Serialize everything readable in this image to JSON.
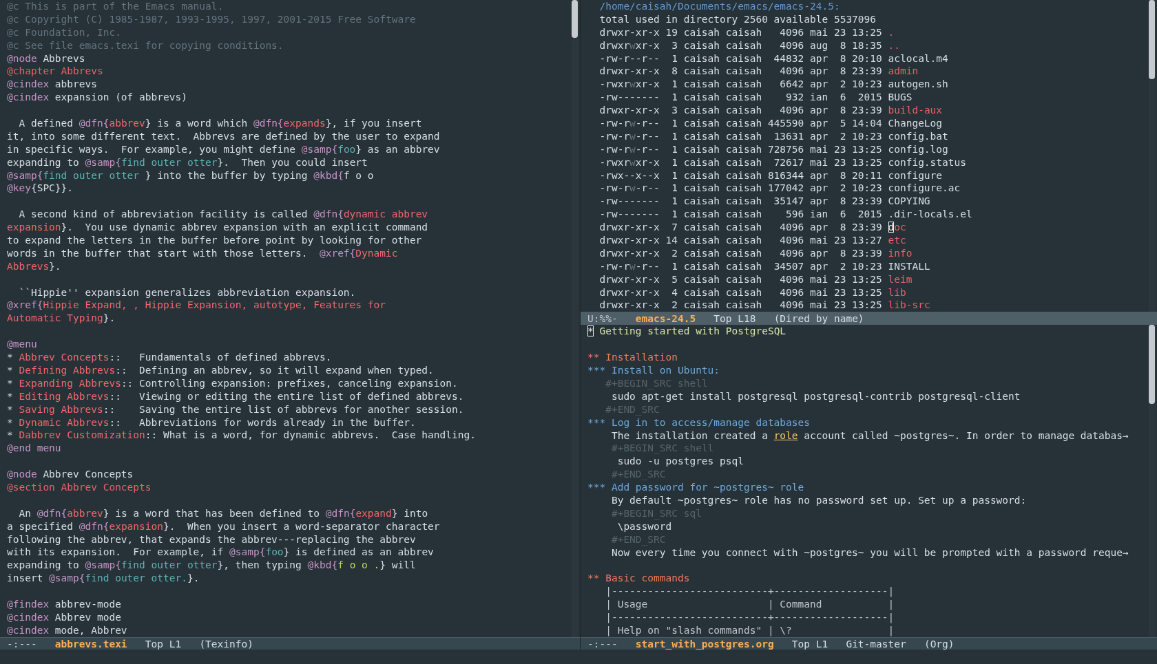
{
  "left_window": {
    "active": false,
    "lines": [
      {
        "kind": "text",
        "spans": [
          {
            "kind": "comment",
            "text": "@c This is part of the Emacs manual."
          }
        ]
      },
      {
        "kind": "text",
        "spans": [
          {
            "kind": "comment",
            "text": "@c Copyright (C) 1985-1987, 1993-1995, 1997, 2001-2015 Free Software"
          }
        ]
      },
      {
        "kind": "text",
        "spans": [
          {
            "kind": "comment",
            "text": "@c Foundation, Inc."
          }
        ]
      },
      {
        "kind": "text",
        "spans": [
          {
            "kind": "comment",
            "text": "@c See file emacs.texi for copying conditions."
          }
        ]
      },
      {
        "kind": "text",
        "spans": [
          {
            "kind": "kw",
            "text": "@node"
          },
          {
            "kind": "plain",
            "text": " Abbrevs"
          }
        ]
      },
      {
        "kind": "text",
        "spans": [
          {
            "kind": "chapter",
            "text": "@chapter Abbrevs"
          }
        ]
      },
      {
        "kind": "text",
        "spans": [
          {
            "kind": "kw",
            "text": "@cindex"
          },
          {
            "kind": "plain",
            "text": " abbrevs"
          }
        ]
      },
      {
        "kind": "text",
        "spans": [
          {
            "kind": "kw",
            "text": "@cindex"
          },
          {
            "kind": "plain",
            "text": " expansion (of abbrevs)"
          }
        ]
      },
      {
        "kind": "blank"
      },
      {
        "kind": "text",
        "spans": [
          {
            "kind": "plain",
            "text": "  A defined "
          },
          {
            "kind": "kw",
            "text": "@dfn{"
          },
          {
            "kind": "str",
            "text": "abbrev"
          },
          {
            "kind": "plain",
            "text": "} is a word which "
          },
          {
            "kind": "kw",
            "text": "@dfn{"
          },
          {
            "kind": "str",
            "text": "expands"
          },
          {
            "kind": "plain",
            "text": "}, if you insert"
          }
        ]
      },
      {
        "kind": "text",
        "spans": [
          {
            "kind": "plain",
            "text": "it, into some different text.  Abbrevs are defined by the user to expand"
          }
        ]
      },
      {
        "kind": "text",
        "spans": [
          {
            "kind": "plain",
            "text": "in specific ways.  For example, you might define "
          },
          {
            "kind": "kw",
            "text": "@samp{"
          },
          {
            "kind": "samp",
            "text": "foo"
          },
          {
            "kind": "plain",
            "text": "} as an abbrev"
          }
        ]
      },
      {
        "kind": "text",
        "spans": [
          {
            "kind": "plain",
            "text": "expanding to "
          },
          {
            "kind": "kw",
            "text": "@samp{"
          },
          {
            "kind": "samp",
            "text": "find outer otter"
          },
          {
            "kind": "plain",
            "text": "}.  Then you could insert"
          }
        ]
      },
      {
        "kind": "text",
        "spans": [
          {
            "kind": "kw",
            "text": "@samp{"
          },
          {
            "kind": "samp",
            "text": "find outer otter "
          },
          {
            "kind": "plain",
            "text": "} into the buffer by typing "
          },
          {
            "kind": "kw",
            "text": "@kbd{"
          },
          {
            "kind": "plain",
            "text": "f o o"
          }
        ]
      },
      {
        "kind": "text",
        "spans": [
          {
            "kind": "kw",
            "text": "@key"
          },
          {
            "kind": "plain",
            "text": "{SPC}}."
          }
        ]
      },
      {
        "kind": "blank"
      },
      {
        "kind": "text",
        "spans": [
          {
            "kind": "plain",
            "text": "  A second kind of abbreviation facility is called "
          },
          {
            "kind": "kw",
            "text": "@dfn{"
          },
          {
            "kind": "str",
            "text": "dynamic abbrev"
          }
        ]
      },
      {
        "kind": "text",
        "spans": [
          {
            "kind": "str",
            "text": "expansion"
          },
          {
            "kind": "plain",
            "text": "}.  You use dynamic abbrev expansion with an explicit command"
          }
        ]
      },
      {
        "kind": "text",
        "spans": [
          {
            "kind": "plain",
            "text": "to expand the letters in the buffer before point by looking for other"
          }
        ]
      },
      {
        "kind": "text",
        "spans": [
          {
            "kind": "plain",
            "text": "words in the buffer that start with those letters.  "
          },
          {
            "kind": "kw",
            "text": "@xref{"
          },
          {
            "kind": "str",
            "text": "Dynamic"
          }
        ]
      },
      {
        "kind": "text",
        "spans": [
          {
            "kind": "str",
            "text": "Abbrevs"
          },
          {
            "kind": "plain",
            "text": "}."
          }
        ]
      },
      {
        "kind": "blank"
      },
      {
        "kind": "text",
        "spans": [
          {
            "kind": "plain",
            "text": "  ``Hippie'' expansion generalizes abbreviation expansion."
          }
        ]
      },
      {
        "kind": "text",
        "spans": [
          {
            "kind": "kw",
            "text": "@xref{"
          },
          {
            "kind": "str",
            "text": "Hippie Expand, , Hippie Expansion, autotype, Features for"
          }
        ]
      },
      {
        "kind": "text",
        "spans": [
          {
            "kind": "str",
            "text": "Automatic Typing"
          },
          {
            "kind": "plain",
            "text": "}."
          }
        ]
      },
      {
        "kind": "blank"
      },
      {
        "kind": "text",
        "spans": [
          {
            "kind": "kw",
            "text": "@menu"
          }
        ]
      },
      {
        "kind": "text",
        "spans": [
          {
            "kind": "plain",
            "text": "* "
          },
          {
            "kind": "str",
            "text": "Abbrev Concepts"
          },
          {
            "kind": "plain",
            "text": "::   Fundamentals of defined abbrevs."
          }
        ]
      },
      {
        "kind": "text",
        "spans": [
          {
            "kind": "plain",
            "text": "* "
          },
          {
            "kind": "str",
            "text": "Defining Abbrevs"
          },
          {
            "kind": "plain",
            "text": "::  Defining an abbrev, so it will expand when typed."
          }
        ]
      },
      {
        "kind": "text",
        "spans": [
          {
            "kind": "plain",
            "text": "* "
          },
          {
            "kind": "str",
            "text": "Expanding Abbrevs"
          },
          {
            "kind": "plain",
            "text": ":: Controlling expansion: prefixes, canceling expansion."
          }
        ]
      },
      {
        "kind": "text",
        "spans": [
          {
            "kind": "plain",
            "text": "* "
          },
          {
            "kind": "str",
            "text": "Editing Abbrevs"
          },
          {
            "kind": "plain",
            "text": "::   Viewing or editing the entire list of defined abbrevs."
          }
        ]
      },
      {
        "kind": "text",
        "spans": [
          {
            "kind": "plain",
            "text": "* "
          },
          {
            "kind": "str",
            "text": "Saving Abbrevs"
          },
          {
            "kind": "plain",
            "text": "::    Saving the entire list of abbrevs for another session."
          }
        ]
      },
      {
        "kind": "text",
        "spans": [
          {
            "kind": "plain",
            "text": "* "
          },
          {
            "kind": "str",
            "text": "Dynamic Abbrevs"
          },
          {
            "kind": "plain",
            "text": "::   Abbreviations for words already in the buffer."
          }
        ]
      },
      {
        "kind": "text",
        "spans": [
          {
            "kind": "plain",
            "text": "* "
          },
          {
            "kind": "str",
            "text": "Dabbrev Customization"
          },
          {
            "kind": "plain",
            "text": ":: What is a word, for dynamic abbrevs.  Case handling."
          }
        ]
      },
      {
        "kind": "text",
        "spans": [
          {
            "kind": "kw",
            "text": "@end menu"
          }
        ]
      },
      {
        "kind": "blank"
      },
      {
        "kind": "text",
        "spans": [
          {
            "kind": "kw",
            "text": "@node"
          },
          {
            "kind": "plain",
            "text": " Abbrev Concepts"
          }
        ]
      },
      {
        "kind": "text",
        "spans": [
          {
            "kind": "chapter",
            "text": "@section Abbrev Concepts"
          }
        ]
      },
      {
        "kind": "blank"
      },
      {
        "kind": "text",
        "spans": [
          {
            "kind": "plain",
            "text": "  An "
          },
          {
            "kind": "kw",
            "text": "@dfn{"
          },
          {
            "kind": "str",
            "text": "abbrev"
          },
          {
            "kind": "plain",
            "text": "} is a word that has been defined to "
          },
          {
            "kind": "kw",
            "text": "@dfn{"
          },
          {
            "kind": "str",
            "text": "expand"
          },
          {
            "kind": "plain",
            "text": "} into"
          }
        ]
      },
      {
        "kind": "text",
        "spans": [
          {
            "kind": "plain",
            "text": "a specified "
          },
          {
            "kind": "kw",
            "text": "@dfn{"
          },
          {
            "kind": "str",
            "text": "expansion"
          },
          {
            "kind": "plain",
            "text": "}.  When you insert a word-separator character"
          }
        ]
      },
      {
        "kind": "text",
        "spans": [
          {
            "kind": "plain",
            "text": "following the abbrev, that expands the abbrev---replacing the abbrev"
          }
        ]
      },
      {
        "kind": "text",
        "spans": [
          {
            "kind": "plain",
            "text": "with its expansion.  For example, if "
          },
          {
            "kind": "kw",
            "text": "@samp{"
          },
          {
            "kind": "samp",
            "text": "foo"
          },
          {
            "kind": "plain",
            "text": "} is defined as an abbrev"
          }
        ]
      },
      {
        "kind": "text",
        "spans": [
          {
            "kind": "plain",
            "text": "expanding to "
          },
          {
            "kind": "kw",
            "text": "@samp{"
          },
          {
            "kind": "samp",
            "text": "find outer otter"
          },
          {
            "kind": "plain",
            "text": "}, then typing "
          },
          {
            "kind": "kw",
            "text": "@kbd{"
          },
          {
            "kind": "kbd",
            "text": "f o o ."
          },
          {
            "kind": "plain",
            "text": "} will"
          }
        ]
      },
      {
        "kind": "text",
        "spans": [
          {
            "kind": "plain",
            "text": "insert "
          },
          {
            "kind": "kw",
            "text": "@samp{"
          },
          {
            "kind": "samp",
            "text": "find outer otter."
          },
          {
            "kind": "plain",
            "text": "}."
          }
        ]
      },
      {
        "kind": "blank"
      },
      {
        "kind": "text",
        "spans": [
          {
            "kind": "kw",
            "text": "@findex"
          },
          {
            "kind": "plain",
            "text": " abbrev-mode"
          }
        ]
      },
      {
        "kind": "text",
        "spans": [
          {
            "kind": "kw",
            "text": "@cindex"
          },
          {
            "kind": "plain",
            "text": " Abbrev mode"
          }
        ]
      },
      {
        "kind": "text",
        "spans": [
          {
            "kind": "kw",
            "text": "@cindex"
          },
          {
            "kind": "plain",
            "text": " mode, Abbrev"
          }
        ]
      }
    ],
    "mode_line": [
      {
        "kind": "status",
        "text": "-:---"
      },
      {
        "kind": "buffer",
        "text": "abbrevs.texi"
      },
      {
        "kind": "position",
        "text": "Top L1"
      },
      {
        "kind": "mode",
        "text": "(Texinfo)"
      }
    ]
  },
  "dired_window": {
    "active": true,
    "lines": [
      {
        "kind": "text",
        "spans": [
          {
            "kind": "path",
            "text": "  /home/caisah/Documents/emacs/emacs-24.5:"
          }
        ]
      },
      {
        "kind": "text",
        "spans": [
          {
            "kind": "plain",
            "text": "  total used in directory 2560 available 5537096"
          }
        ]
      },
      {
        "kind": "text",
        "spans": [
          {
            "kind": "plain",
            "text": "  drwxr-xr-x 19 caisah caisah   4096 mai 23 13:25 "
          },
          {
            "kind": "dir",
            "text": "."
          }
        ]
      },
      {
        "kind": "text",
        "spans": [
          {
            "kind": "plain",
            "text": "  drwxr"
          },
          {
            "kind": "dim",
            "text": "w"
          },
          {
            "kind": "plain",
            "text": "xr-x  3 caisah caisah   4096 aug  8 18:35 "
          },
          {
            "kind": "dir",
            "text": ".."
          }
        ]
      },
      {
        "kind": "text",
        "spans": [
          {
            "kind": "plain",
            "text": "  -rw-r--r--  1 caisah caisah  44832 apr  8 20:10 aclocal.m4"
          }
        ]
      },
      {
        "kind": "text",
        "spans": [
          {
            "kind": "plain",
            "text": "  drwxr-xr-x  8 caisah caisah   4096 apr  8 23:39 "
          },
          {
            "kind": "dir",
            "text": "admin"
          }
        ]
      },
      {
        "kind": "text",
        "spans": [
          {
            "kind": "plain",
            "text": "  -rwxr"
          },
          {
            "kind": "dim",
            "text": "w"
          },
          {
            "kind": "plain",
            "text": "xr-x  1 caisah caisah   6642 apr  2 10:23 autogen.sh"
          }
        ]
      },
      {
        "kind": "text",
        "spans": [
          {
            "kind": "plain",
            "text": "  -rw-------  1 caisah caisah    932 ian  6  2015 BUGS"
          }
        ]
      },
      {
        "kind": "text",
        "spans": [
          {
            "kind": "plain",
            "text": "  drwxr-xr-x  3 caisah caisah   4096 apr  8 23:39 "
          },
          {
            "kind": "dir",
            "text": "build-aux"
          }
        ]
      },
      {
        "kind": "text",
        "spans": [
          {
            "kind": "plain",
            "text": "  -rw-r"
          },
          {
            "kind": "dim",
            "text": "w"
          },
          {
            "kind": "plain",
            "text": "-r--  1 caisah caisah 445590 apr  5 14:04 ChangeLog"
          }
        ]
      },
      {
        "kind": "text",
        "spans": [
          {
            "kind": "plain",
            "text": "  -rw-r"
          },
          {
            "kind": "dim",
            "text": "w"
          },
          {
            "kind": "plain",
            "text": "-r--  1 caisah caisah  13631 apr  2 10:23 config.bat"
          }
        ]
      },
      {
        "kind": "text",
        "spans": [
          {
            "kind": "plain",
            "text": "  -rw-r"
          },
          {
            "kind": "dim",
            "text": "w"
          },
          {
            "kind": "plain",
            "text": "-r--  1 caisah caisah 728756 mai 23 13:25 config.log"
          }
        ]
      },
      {
        "kind": "text",
        "spans": [
          {
            "kind": "plain",
            "text": "  -rwxr"
          },
          {
            "kind": "dim",
            "text": "w"
          },
          {
            "kind": "plain",
            "text": "xr-x  1 caisah caisah  72617 mai 23 13:25 config.status"
          }
        ]
      },
      {
        "kind": "text",
        "spans": [
          {
            "kind": "plain",
            "text": "  -rwx--x--x  1 caisah caisah 816344 apr  8 20:11 configure"
          }
        ]
      },
      {
        "kind": "text",
        "spans": [
          {
            "kind": "plain",
            "text": "  -rw-r"
          },
          {
            "kind": "dim",
            "text": "w"
          },
          {
            "kind": "plain",
            "text": "-r--  1 caisah caisah 177042 apr  2 10:23 configure.ac"
          }
        ]
      },
      {
        "kind": "text",
        "spans": [
          {
            "kind": "plain",
            "text": "  -rw-------  1 caisah caisah  35147 apr  8 23:39 COPYING"
          }
        ]
      },
      {
        "kind": "text",
        "spans": [
          {
            "kind": "plain",
            "text": "  -rw-------  1 caisah caisah    596 ian  6  2015 .dir-locals.el"
          }
        ]
      },
      {
        "kind": "text",
        "spans": [
          {
            "kind": "plain",
            "text": "  drwxr-xr-x  7 caisah caisah   4096 apr  8 23:39 "
          },
          {
            "kind": "cursor",
            "text": "d"
          },
          {
            "kind": "dir",
            "text": "oc"
          }
        ]
      },
      {
        "kind": "text",
        "spans": [
          {
            "kind": "plain",
            "text": "  drwxr-xr-x 14 caisah caisah   4096 mai 23 13:27 "
          },
          {
            "kind": "dir",
            "text": "etc"
          }
        ]
      },
      {
        "kind": "text",
        "spans": [
          {
            "kind": "plain",
            "text": "  drwxr-xr-x  2 caisah caisah   4096 apr  8 23:39 "
          },
          {
            "kind": "dir",
            "text": "info"
          }
        ]
      },
      {
        "kind": "text",
        "spans": [
          {
            "kind": "plain",
            "text": "  -rw-r"
          },
          {
            "kind": "dim",
            "text": "w"
          },
          {
            "kind": "plain",
            "text": "-r--  1 caisah caisah  34507 apr  2 10:23 INSTALL"
          }
        ]
      },
      {
        "kind": "text",
        "spans": [
          {
            "kind": "plain",
            "text": "  drwxr-xr-x  5 caisah caisah   4096 mai 23 13:25 "
          },
          {
            "kind": "dir",
            "text": "leim"
          }
        ]
      },
      {
        "kind": "text",
        "spans": [
          {
            "kind": "plain",
            "text": "  drwxr-xr-x  4 caisah caisah   4096 mai 23 13:25 "
          },
          {
            "kind": "dir",
            "text": "lib"
          }
        ]
      },
      {
        "kind": "text",
        "spans": [
          {
            "kind": "plain",
            "text": "  drwxr-xr-x  2 caisah caisah   4096 mai 23 13:25 "
          },
          {
            "kind": "dir",
            "text": "lib-src"
          }
        ]
      }
    ],
    "mode_line": [
      {
        "kind": "status",
        "text": "U:%%-"
      },
      {
        "kind": "buffer",
        "text": "emacs-24.5"
      },
      {
        "kind": "position",
        "text": "Top L18"
      },
      {
        "kind": "mode",
        "text": "(Dired by name)"
      }
    ]
  },
  "org_window": {
    "active": false,
    "lines": [
      {
        "kind": "text",
        "spans": [
          {
            "kind": "cursor",
            "text": "*"
          },
          {
            "kind": "title",
            "text": " Getting started with PostgreSQL"
          }
        ]
      },
      {
        "kind": "blank"
      },
      {
        "kind": "text",
        "spans": [
          {
            "kind": "h1",
            "text": "** Installation"
          }
        ]
      },
      {
        "kind": "text",
        "spans": [
          {
            "kind": "h2",
            "text": "*** Install on Ubuntu:"
          }
        ]
      },
      {
        "kind": "text",
        "spans": [
          {
            "kind": "meta",
            "text": "   #+BEGIN_SRC shell"
          }
        ]
      },
      {
        "kind": "text",
        "spans": [
          {
            "kind": "plain",
            "text": "    sudo apt-get install postgresql postgresql-contrib postgresql-client"
          }
        ]
      },
      {
        "kind": "text",
        "spans": [
          {
            "kind": "meta",
            "text": "   #+END_SRC"
          }
        ]
      },
      {
        "kind": "text",
        "spans": [
          {
            "kind": "h2",
            "text": "*** Log in to access/manage databases"
          }
        ]
      },
      {
        "kind": "text",
        "spans": [
          {
            "kind": "plain",
            "text": "    The installation created a "
          },
          {
            "kind": "link",
            "text": "role"
          },
          {
            "kind": "plain",
            "text": " account called ~postgres~. In order to manage databas"
          },
          {
            "kind": "cont",
            "text": "→"
          }
        ]
      },
      {
        "kind": "text",
        "spans": [
          {
            "kind": "meta",
            "text": "    #+BEGIN_SRC shell"
          }
        ]
      },
      {
        "kind": "text",
        "spans": [
          {
            "kind": "plain",
            "text": "     sudo -u postgres psql"
          }
        ]
      },
      {
        "kind": "text",
        "spans": [
          {
            "kind": "meta",
            "text": "    #+END_SRC"
          }
        ]
      },
      {
        "kind": "text",
        "spans": [
          {
            "kind": "h2",
            "text": "*** Add password for ~postgres~ role"
          }
        ]
      },
      {
        "kind": "text",
        "spans": [
          {
            "kind": "plain",
            "text": "    By default ~postgres~ role has no password set up. Set up a password:"
          }
        ]
      },
      {
        "kind": "text",
        "spans": [
          {
            "kind": "meta",
            "text": "    #+BEGIN_SRC sql"
          }
        ]
      },
      {
        "kind": "text",
        "spans": [
          {
            "kind": "plain",
            "text": "     \\password"
          }
        ]
      },
      {
        "kind": "text",
        "spans": [
          {
            "kind": "meta",
            "text": "    #+END_SRC"
          }
        ]
      },
      {
        "kind": "text",
        "spans": [
          {
            "kind": "plain",
            "text": "    Now every time you connect with ~postgres~ you will be prompted with a password reque"
          },
          {
            "kind": "cont",
            "text": "→"
          }
        ]
      },
      {
        "kind": "blank"
      },
      {
        "kind": "text",
        "spans": [
          {
            "kind": "h1",
            "text": "** Basic commands"
          }
        ]
      },
      {
        "kind": "text",
        "spans": [
          {
            "kind": "table",
            "text": "   |--------------------------+-------------------|"
          }
        ]
      },
      {
        "kind": "text",
        "spans": [
          {
            "kind": "table",
            "text": "   | Usage                    | Command           |"
          }
        ]
      },
      {
        "kind": "text",
        "spans": [
          {
            "kind": "table",
            "text": "   |--------------------------+-------------------|"
          }
        ]
      },
      {
        "kind": "text",
        "spans": [
          {
            "kind": "table",
            "text": "   | Help on \"slash commands\" | \\?                |"
          }
        ]
      }
    ],
    "mode_line": [
      {
        "kind": "status",
        "text": "-:---"
      },
      {
        "kind": "buffer",
        "text": "start_with_postgres.org"
      },
      {
        "kind": "position",
        "text": "Top L1"
      },
      {
        "kind": "vc",
        "text": "Git-master"
      },
      {
        "kind": "mode",
        "text": "(Org)"
      }
    ]
  }
}
